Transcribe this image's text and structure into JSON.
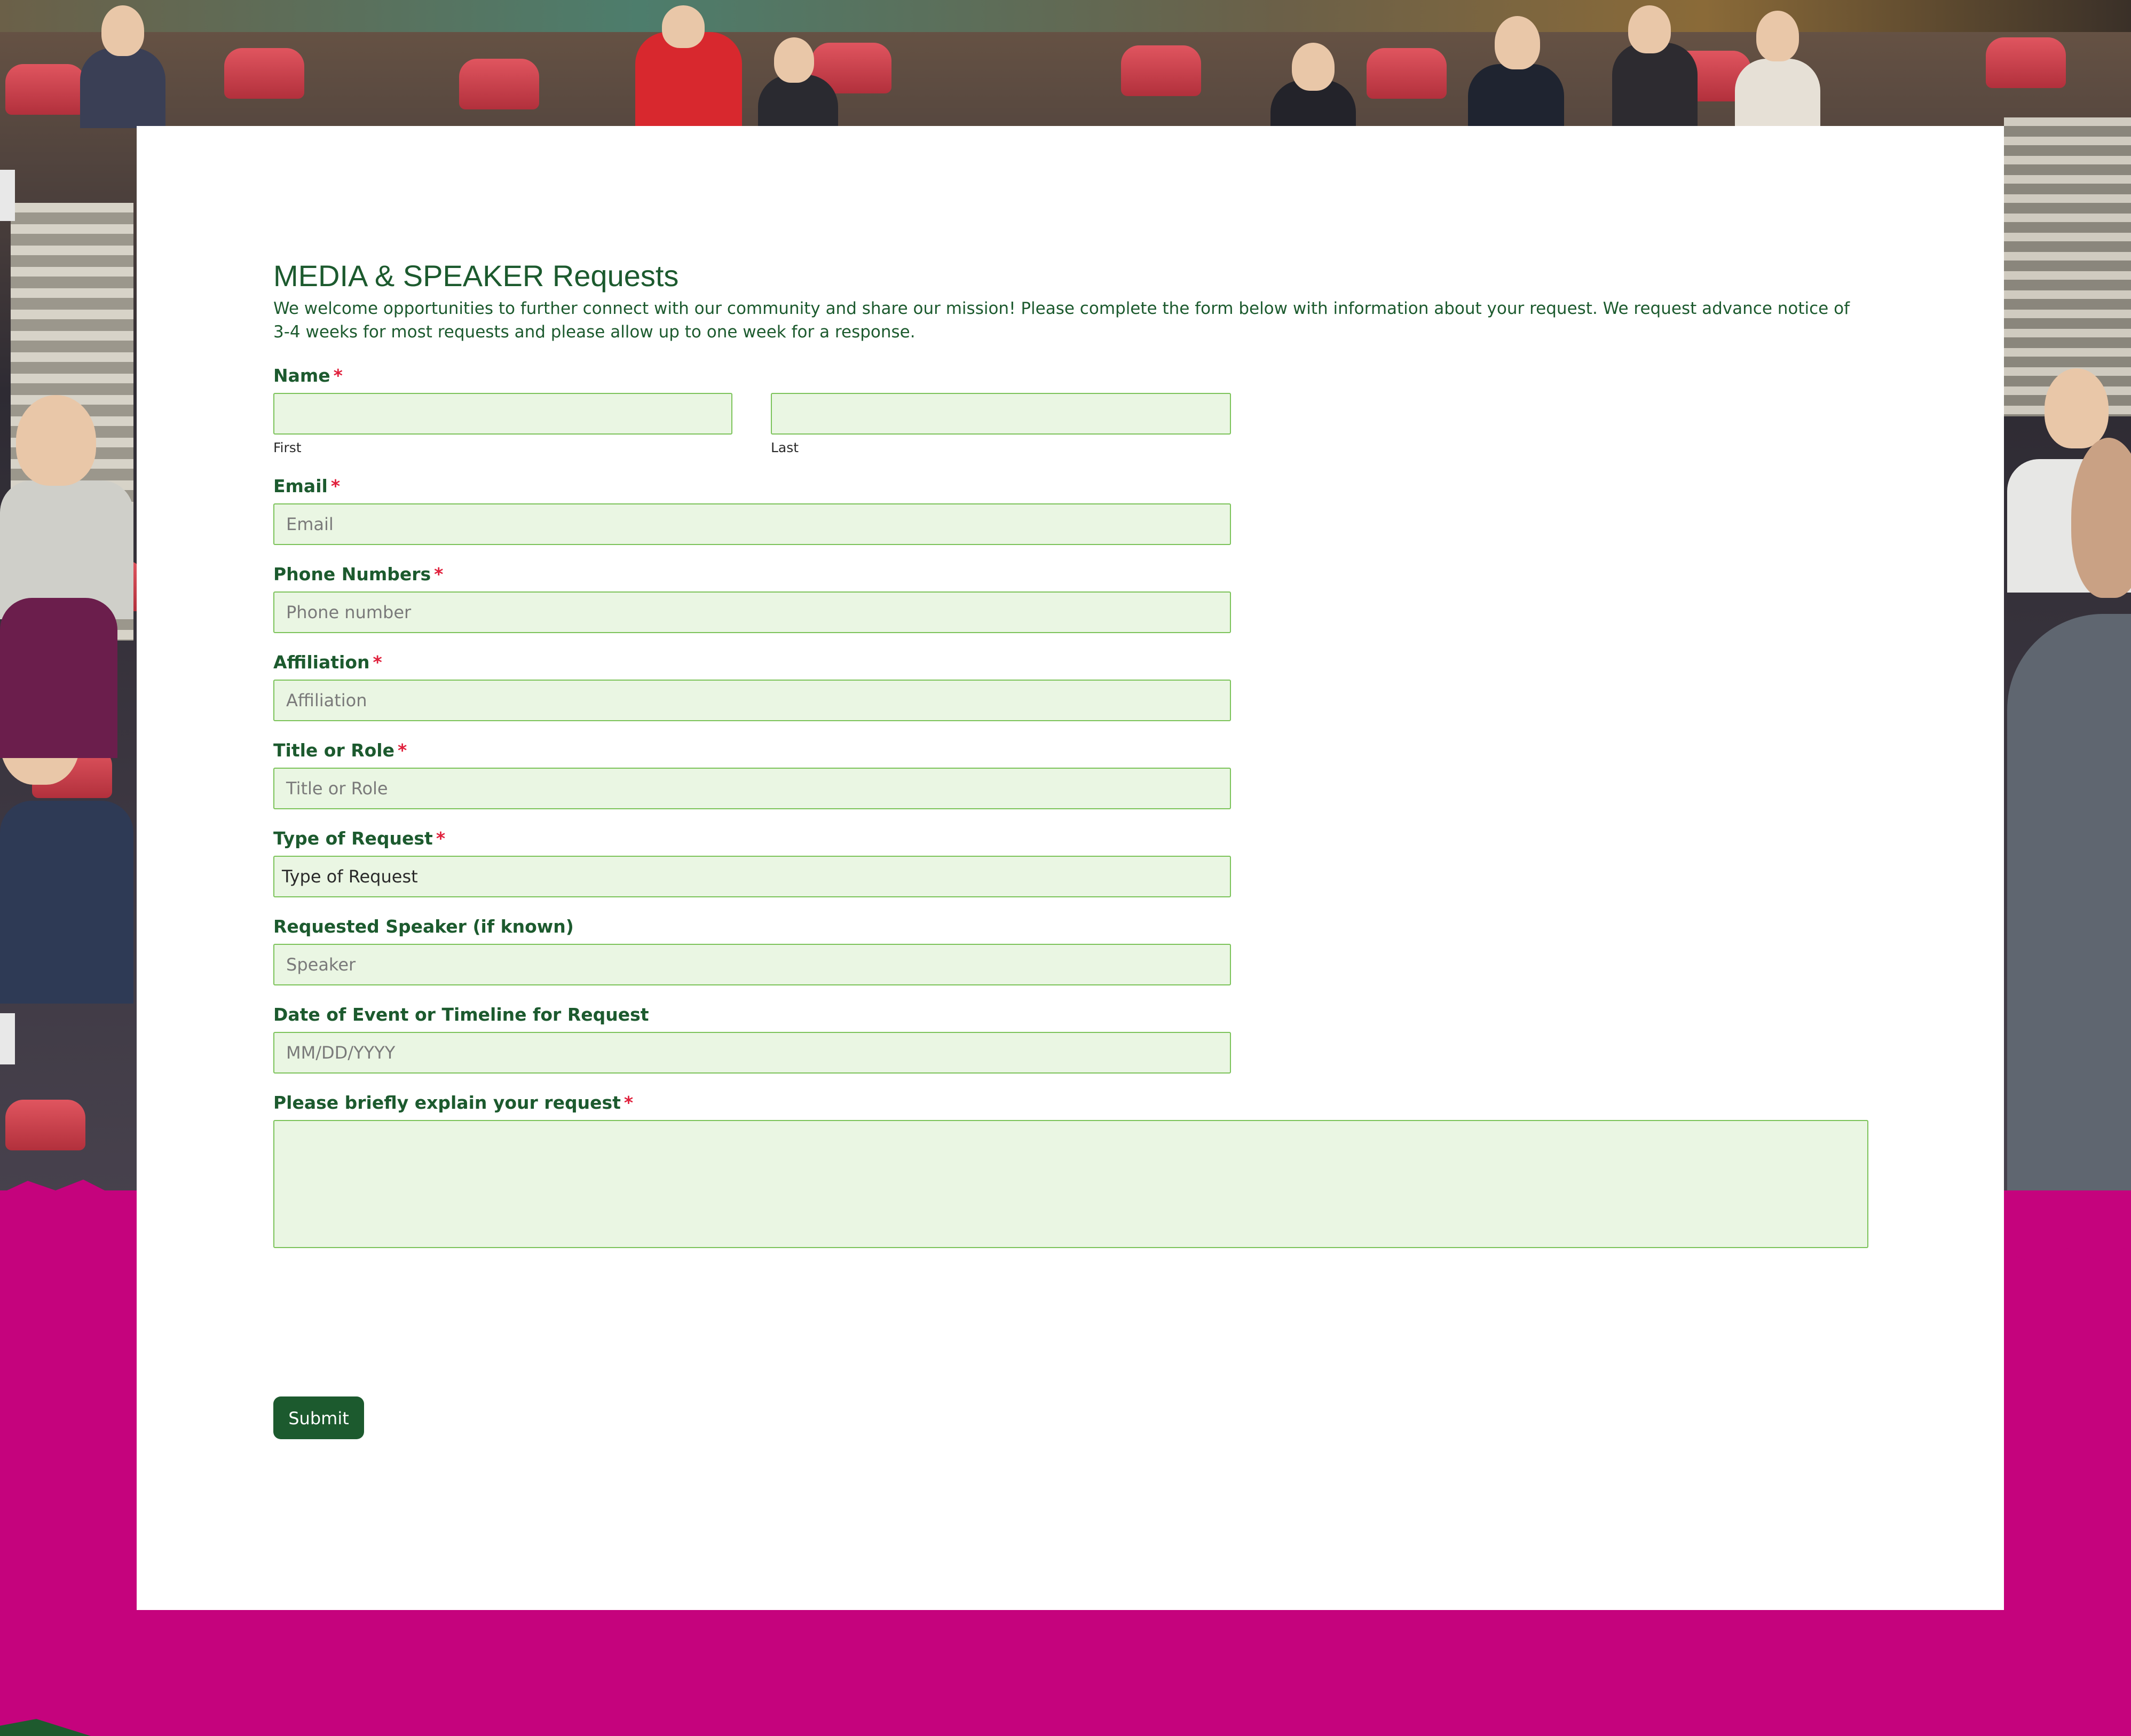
{
  "form": {
    "title": "MEDIA & SPEAKER Requests",
    "intro": "We welcome opportunities to further connect with our community and share our mission! Please complete the form below with information about your request. We request advance notice of 3-4 weeks for most requests and please allow up to one week for a response.",
    "required_marker": "*",
    "name": {
      "label": "Name",
      "first_sublabel": "First",
      "last_sublabel": "Last",
      "first_value": "",
      "last_value": ""
    },
    "email": {
      "label": "Email",
      "placeholder": "Email"
    },
    "phone": {
      "label": "Phone Numbers",
      "placeholder": "Phone number"
    },
    "affiliation": {
      "label": "Affiliation",
      "placeholder": "Affiliation"
    },
    "title_role": {
      "label": "Title or Role",
      "placeholder": "Title or Role"
    },
    "request_type": {
      "label": "Type of Request",
      "selected": "Type of Request"
    },
    "speaker": {
      "label": "Requested Speaker (if known)",
      "placeholder": "Speaker"
    },
    "date": {
      "label": "Date of Event or Timeline for Request",
      "placeholder": "MM/DD/YYYY"
    },
    "explain": {
      "label": "Please briefly explain your request",
      "value": ""
    },
    "submit_label": "Submit"
  },
  "colors": {
    "brand_green": "#1c5a2e",
    "required_red": "#e0203c",
    "input_bg": "#eaf6e3",
    "input_border": "#7cc35a",
    "page_magenta": "#c5037d"
  }
}
